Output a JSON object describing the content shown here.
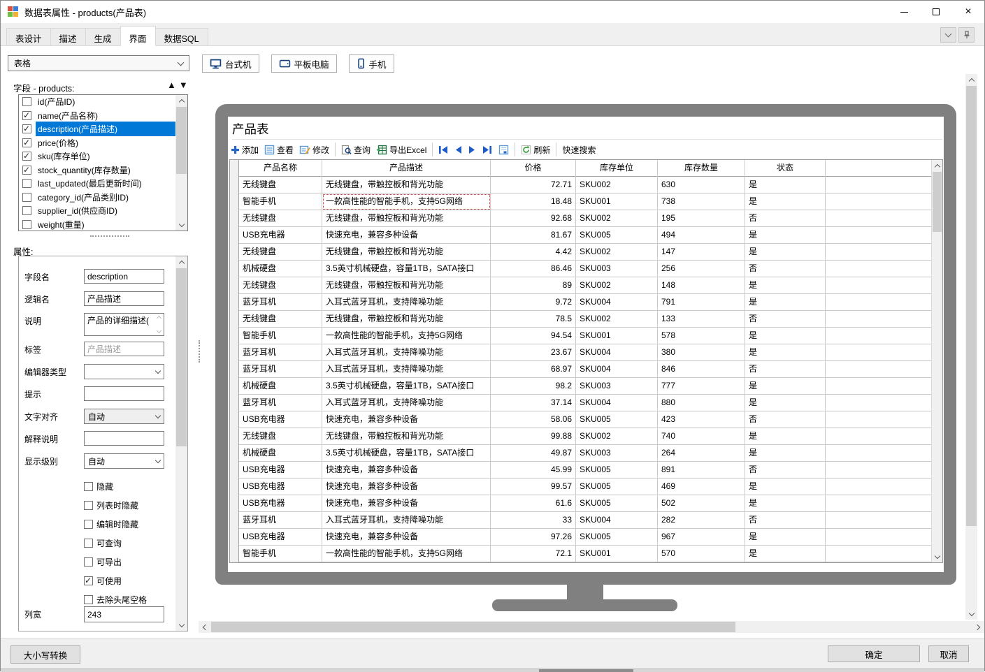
{
  "window": {
    "title": "数据表属性 - products(产品表)"
  },
  "tabs": [
    {
      "label": "表设计",
      "active": false
    },
    {
      "label": "描述",
      "active": false
    },
    {
      "label": "生成",
      "active": false
    },
    {
      "label": "界面",
      "active": true
    },
    {
      "label": "数据SQL",
      "active": false
    }
  ],
  "fields_panel": {
    "view_selector_value": "表格",
    "fields_label": "字段 - products:",
    "fields": [
      {
        "label": "id(产品ID)",
        "checked": false,
        "selected": false
      },
      {
        "label": "name(产品名称)",
        "checked": true,
        "selected": false
      },
      {
        "label": "description(产品描述)",
        "checked": true,
        "selected": true
      },
      {
        "label": "price(价格)",
        "checked": true,
        "selected": false
      },
      {
        "label": "sku(库存单位)",
        "checked": true,
        "selected": false
      },
      {
        "label": "stock_quantity(库存数量)",
        "checked": true,
        "selected": false
      },
      {
        "label": "last_updated(最后更新时间)",
        "checked": false,
        "selected": false
      },
      {
        "label": "category_id(产品类别ID)",
        "checked": false,
        "selected": false
      },
      {
        "label": "supplier_id(供应商ID)",
        "checked": false,
        "selected": false
      },
      {
        "label": "weight(重量)",
        "checked": false,
        "selected": false
      }
    ]
  },
  "properties": {
    "title": "属性:",
    "field_name": {
      "label": "字段名",
      "value": "description"
    },
    "logical_name": {
      "label": "逻辑名",
      "value": "产品描述"
    },
    "description": {
      "label": "说明",
      "value": "产品的详细描述("
    },
    "tag": {
      "label": "标签",
      "value": "产品描述"
    },
    "editor_type": {
      "label": "编辑器类型",
      "value": ""
    },
    "hint": {
      "label": "提示",
      "value": ""
    },
    "text_align": {
      "label": "文字对齐",
      "value": "自动"
    },
    "explain": {
      "label": "解释说明",
      "value": ""
    },
    "display_level": {
      "label": "显示级别",
      "value": "自动"
    },
    "options": [
      {
        "label": "隐藏",
        "checked": false
      },
      {
        "label": "列表时隐藏",
        "checked": false
      },
      {
        "label": "编辑时隐藏",
        "checked": false
      },
      {
        "label": "可查询",
        "checked": false
      },
      {
        "label": "可导出",
        "checked": false
      },
      {
        "label": "可使用",
        "checked": true
      },
      {
        "label": "去除头尾空格",
        "checked": false
      }
    ],
    "column_width": {
      "label": "列宽",
      "value": "243"
    }
  },
  "device_buttons": {
    "desktop": "台式机",
    "tablet": "平板电脑",
    "phone": "手机"
  },
  "preview": {
    "table_title": "产品表",
    "toolbar": {
      "add": "添加",
      "view": "查看",
      "edit": "修改",
      "query": "查询",
      "export_excel": "导出Excel",
      "refresh": "刷新",
      "quick_search": "快速搜索"
    },
    "columns": {
      "name": "产品名称",
      "desc": "产品描述",
      "price": "价格",
      "sku": "库存单位",
      "qty": "库存数量",
      "status": "状态"
    },
    "rows": [
      {
        "name": "无线键盘",
        "desc": "无线键盘，带触控板和背光功能",
        "price": "72.71",
        "sku": "SKU002",
        "qty": "630",
        "status": "是",
        "focused": false
      },
      {
        "name": "智能手机",
        "desc": "一款高性能的智能手机，支持5G网络",
        "price": "18.48",
        "sku": "SKU001",
        "qty": "738",
        "status": "是",
        "focused": true
      },
      {
        "name": "无线键盘",
        "desc": "无线键盘，带触控板和背光功能",
        "price": "92.68",
        "sku": "SKU002",
        "qty": "195",
        "status": "否",
        "focused": false
      },
      {
        "name": "USB充电器",
        "desc": "快速充电，兼容多种设备",
        "price": "81.67",
        "sku": "SKU005",
        "qty": "494",
        "status": "是",
        "focused": false
      },
      {
        "name": "无线键盘",
        "desc": "无线键盘，带触控板和背光功能",
        "price": "4.42",
        "sku": "SKU002",
        "qty": "147",
        "status": "是",
        "focused": false
      },
      {
        "name": "机械硬盘",
        "desc": "3.5英寸机械硬盘，容量1TB，SATA接口",
        "price": "86.46",
        "sku": "SKU003",
        "qty": "256",
        "status": "否",
        "focused": false
      },
      {
        "name": "无线键盘",
        "desc": "无线键盘，带触控板和背光功能",
        "price": "89",
        "sku": "SKU002",
        "qty": "148",
        "status": "是",
        "focused": false
      },
      {
        "name": "蓝牙耳机",
        "desc": "入耳式蓝牙耳机，支持降噪功能",
        "price": "9.72",
        "sku": "SKU004",
        "qty": "791",
        "status": "是",
        "focused": false
      },
      {
        "name": "无线键盘",
        "desc": "无线键盘，带触控板和背光功能",
        "price": "78.5",
        "sku": "SKU002",
        "qty": "133",
        "status": "否",
        "focused": false
      },
      {
        "name": "智能手机",
        "desc": "一款高性能的智能手机，支持5G网络",
        "price": "94.54",
        "sku": "SKU001",
        "qty": "578",
        "status": "是",
        "focused": false
      },
      {
        "name": "蓝牙耳机",
        "desc": "入耳式蓝牙耳机，支持降噪功能",
        "price": "23.67",
        "sku": "SKU004",
        "qty": "380",
        "status": "是",
        "focused": false
      },
      {
        "name": "蓝牙耳机",
        "desc": "入耳式蓝牙耳机，支持降噪功能",
        "price": "68.97",
        "sku": "SKU004",
        "qty": "846",
        "status": "否",
        "focused": false
      },
      {
        "name": "机械硬盘",
        "desc": "3.5英寸机械硬盘，容量1TB，SATA接口",
        "price": "98.2",
        "sku": "SKU003",
        "qty": "777",
        "status": "是",
        "focused": false
      },
      {
        "name": "蓝牙耳机",
        "desc": "入耳式蓝牙耳机，支持降噪功能",
        "price": "37.14",
        "sku": "SKU004",
        "qty": "880",
        "status": "是",
        "focused": false
      },
      {
        "name": "USB充电器",
        "desc": "快速充电，兼容多种设备",
        "price": "58.06",
        "sku": "SKU005",
        "qty": "423",
        "status": "否",
        "focused": false
      },
      {
        "name": "无线键盘",
        "desc": "无线键盘，带触控板和背光功能",
        "price": "99.88",
        "sku": "SKU002",
        "qty": "740",
        "status": "是",
        "focused": false
      },
      {
        "name": "机械硬盘",
        "desc": "3.5英寸机械硬盘，容量1TB，SATA接口",
        "price": "49.87",
        "sku": "SKU003",
        "qty": "264",
        "status": "是",
        "focused": false
      },
      {
        "name": "USB充电器",
        "desc": "快速充电，兼容多种设备",
        "price": "45.99",
        "sku": "SKU005",
        "qty": "891",
        "status": "否",
        "focused": false
      },
      {
        "name": "USB充电器",
        "desc": "快速充电，兼容多种设备",
        "price": "99.57",
        "sku": "SKU005",
        "qty": "469",
        "status": "是",
        "focused": false
      },
      {
        "name": "USB充电器",
        "desc": "快速充电，兼容多种设备",
        "price": "61.6",
        "sku": "SKU005",
        "qty": "502",
        "status": "是",
        "focused": false
      },
      {
        "name": "蓝牙耳机",
        "desc": "入耳式蓝牙耳机，支持降噪功能",
        "price": "33",
        "sku": "SKU004",
        "qty": "282",
        "status": "否",
        "focused": false
      },
      {
        "name": "USB充电器",
        "desc": "快速充电，兼容多种设备",
        "price": "97.26",
        "sku": "SKU005",
        "qty": "967",
        "status": "是",
        "focused": false
      },
      {
        "name": "智能手机",
        "desc": "一款高性能的智能手机，支持5G网络",
        "price": "72.1",
        "sku": "SKU001",
        "qty": "570",
        "status": "是",
        "focused": false
      }
    ]
  },
  "footer": {
    "case_convert": "大小写转换",
    "ok": "确定",
    "cancel": "取消"
  }
}
